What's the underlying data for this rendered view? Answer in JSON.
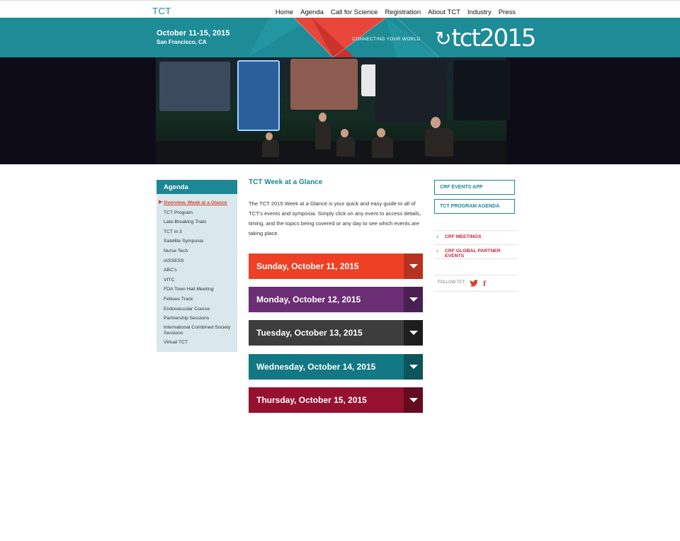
{
  "header": {
    "logo": "TCT",
    "nav": [
      "Home",
      "Agenda",
      "Call for Science",
      "Registration",
      "About TCT",
      "Industry",
      "Press"
    ]
  },
  "banner": {
    "dates": "October 11-15, 2015",
    "location": "San Francisco, CA",
    "tagline": "CONNECTING YOUR WORLD",
    "brand": "tct2015"
  },
  "sidebar": {
    "title": "Agenda",
    "items": [
      "Overview. Week at a Glance",
      "TCT Program",
      "Late-Breaking Trials",
      "TCT in 3",
      "Satellite Symposia",
      "Nurse Tech",
      "iASSESS",
      "ABC's",
      "VITC",
      "FDA Town Hall Meeting",
      "Fellows Track",
      "Endovascular Course",
      "Partnership Sessions",
      "International Combined Society Sessions",
      "Virtual TCT"
    ]
  },
  "main": {
    "title": "TCT Week at a Glance",
    "intro": "The TCT 2015 Week at a Glance is your quick and easy guide to all of TCT's events and symposia. Simply click on any event to access details, timing, and the topics being covered or any day to see which events are taking place.",
    "days": [
      {
        "label": "Sunday, October 11, 2015",
        "color": "#ee4025",
        "toggle": "#b8331f"
      },
      {
        "label": "Monday, October 12, 2015",
        "color": "#6b2d74",
        "toggle": "#4a1f52"
      },
      {
        "label": "Tuesday, October 13, 2015",
        "color": "#3d3d3d",
        "toggle": "#1e1e1e"
      },
      {
        "label": "Wednesday, October 14, 2015",
        "color": "#127984",
        "toggle": "#0c555d"
      },
      {
        "label": "Thursday, October 15, 2015",
        "color": "#96102f",
        "toggle": "#650b20"
      }
    ]
  },
  "right": {
    "buttons": [
      "CRF EVENTS APP",
      "TCT PROGRAM AGENDA"
    ],
    "links": [
      "CRF MEETINGS",
      "CRF GLOBAL PARTNER EVENTS"
    ],
    "follow": "FOLLOW TCT",
    "facebook": "f"
  }
}
